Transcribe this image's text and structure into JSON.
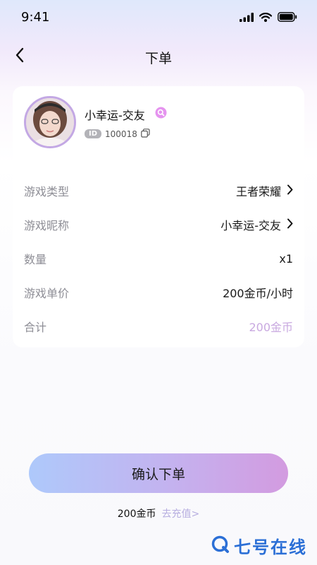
{
  "status_bar": {
    "time": "9:41"
  },
  "nav": {
    "title": "下单"
  },
  "user": {
    "name": "小幸运-交友",
    "id_badge": "ID",
    "id": "100018"
  },
  "order_rows": [
    {
      "label": "游戏类型",
      "value": "王者荣耀",
      "has_arrow": true
    },
    {
      "label": "游戏昵称",
      "value": "小幸运-交友",
      "has_arrow": true
    },
    {
      "label": "数量",
      "value": "x1",
      "has_arrow": false
    },
    {
      "label": "游戏单价",
      "value": "200金币/小时",
      "has_arrow": false
    },
    {
      "label": "合计",
      "value": "200金币",
      "has_arrow": false
    }
  ],
  "confirm_button": {
    "label": "确认下单"
  },
  "footer": {
    "balance": "200金币",
    "recharge": "去充值>"
  },
  "watermark": {
    "text": "七号在线"
  },
  "colors": {
    "accent_purple": "#c9a9e0",
    "button_start": "#aec9fb",
    "button_end": "#d39be0",
    "label_gray": "#8e8e96"
  }
}
